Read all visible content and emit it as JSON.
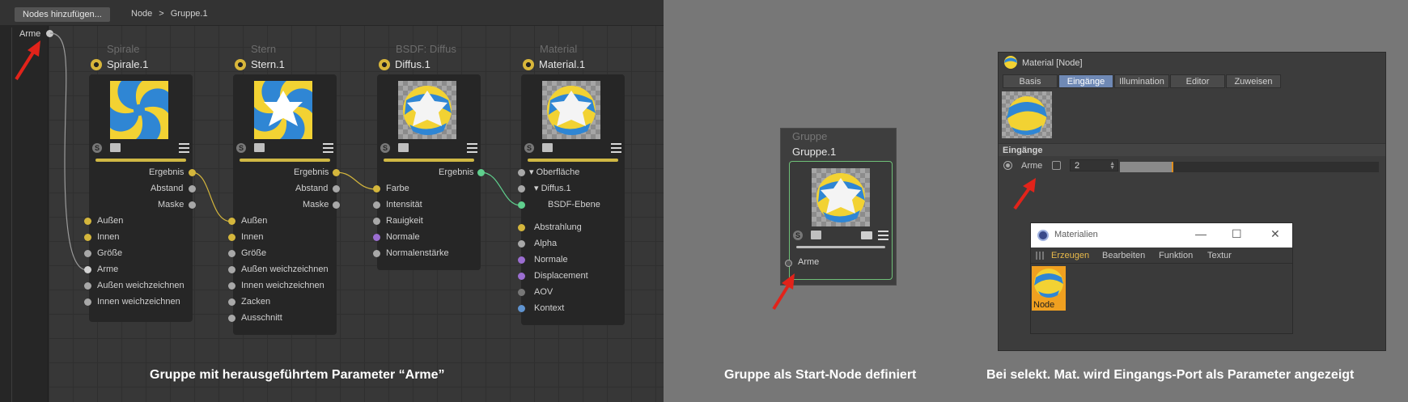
{
  "editor": {
    "add_button": "Nodes hinzufügen...",
    "breadcrumb": [
      "Node",
      ">",
      "Gruppe.1"
    ],
    "input_port": "Arme",
    "nodes": [
      {
        "type": "Spirale",
        "name": "Spirale.1",
        "outputs": [
          "Ergebnis",
          "Abstand",
          "Maske"
        ],
        "inputs": [
          "Außen",
          "Innen",
          "Größe",
          "Arme",
          "Außen weichzeichnen",
          "Innen weichzeichnen"
        ]
      },
      {
        "type": "Stern",
        "name": "Stern.1",
        "outputs": [
          "Ergebnis",
          "Abstand",
          "Maske"
        ],
        "inputs": [
          "Außen",
          "Innen",
          "Größe",
          "Außen weichzeichnen",
          "Innen weichzeichnen",
          "Zacken",
          "Ausschnitt"
        ]
      },
      {
        "type": "BSDF: Diffus",
        "name": "Diffus.1",
        "outputs": [
          "Ergebnis"
        ],
        "inputs": [
          "Farbe",
          "Intensität",
          "Rauigkeit",
          "Normale",
          "Normalenstärke"
        ]
      },
      {
        "type": "Material",
        "name": "Material.1",
        "tree": [
          "Oberfläche",
          "Diffus.1",
          "BSDF-Ebene"
        ],
        "inputs": [
          "Abstrahlung",
          "Alpha",
          "Normale",
          "Displacement",
          "AOV",
          "Kontext"
        ]
      }
    ],
    "caption": "Gruppe mit herausgeführtem Parameter “Arme”"
  },
  "group_node": {
    "type": "Gruppe",
    "name": "Gruppe.1",
    "port": "Arme",
    "caption": "Gruppe als Start-Node definiert"
  },
  "attribute_manager": {
    "title": "Material [Node]",
    "tabs": [
      "Basis",
      "Eingänge",
      "Illumination",
      "Editor",
      "Zuweisen"
    ],
    "active_tab": "Eingänge",
    "section": "Eingänge",
    "param_label": "Arme",
    "param_value": "2",
    "slider_level": 0.2,
    "caption": "Bei selekt. Mat. wird Eingangs-Port als Parameter angezeigt"
  },
  "materials_window": {
    "title": "Materialien",
    "menu": [
      "Erzeugen",
      "Bearbeiten",
      "Funktion",
      "Textur"
    ],
    "highlighted_menu": "Erzeugen",
    "item": "Node"
  }
}
